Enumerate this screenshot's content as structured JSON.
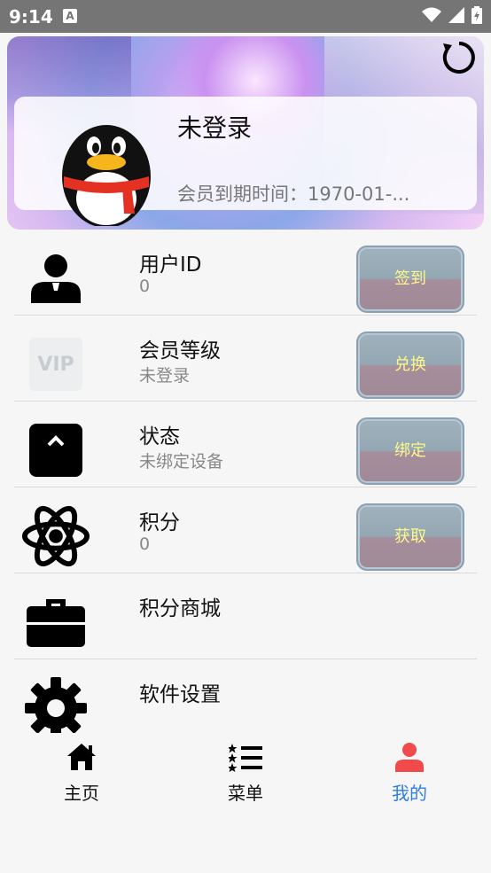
{
  "status_bar": {
    "time": "9:14",
    "notification_letter": "A"
  },
  "profile": {
    "name": "未登录",
    "expiry": "会员到期时间：1970-01-..."
  },
  "rows": [
    {
      "title": "用户ID",
      "subtitle": "0",
      "icon": "user-icon",
      "button": "签到"
    },
    {
      "title": "会员等级",
      "subtitle": "未登录",
      "icon": "vip-icon",
      "icon_text": "VIP",
      "button": "兑换"
    },
    {
      "title": "状态",
      "subtitle": "未绑定设备",
      "icon": "caret-up-box-icon",
      "button": "绑定"
    },
    {
      "title": "积分",
      "subtitle": "0",
      "icon": "atom-icon",
      "button": "获取"
    },
    {
      "title": "积分商城",
      "subtitle": "",
      "icon": "toolbox-icon"
    },
    {
      "title": "软件设置",
      "subtitle": "",
      "icon": "gear-icon"
    }
  ],
  "tabs": [
    {
      "label": "主页",
      "icon": "home-icon",
      "active": false
    },
    {
      "label": "菜单",
      "icon": "list-icon",
      "active": false
    },
    {
      "label": "我的",
      "icon": "person-icon",
      "active": true
    }
  ],
  "colors": {
    "accent": "#2f7de1",
    "active_tab_icon": "#f04a4a",
    "button_text": "#fff68a"
  }
}
